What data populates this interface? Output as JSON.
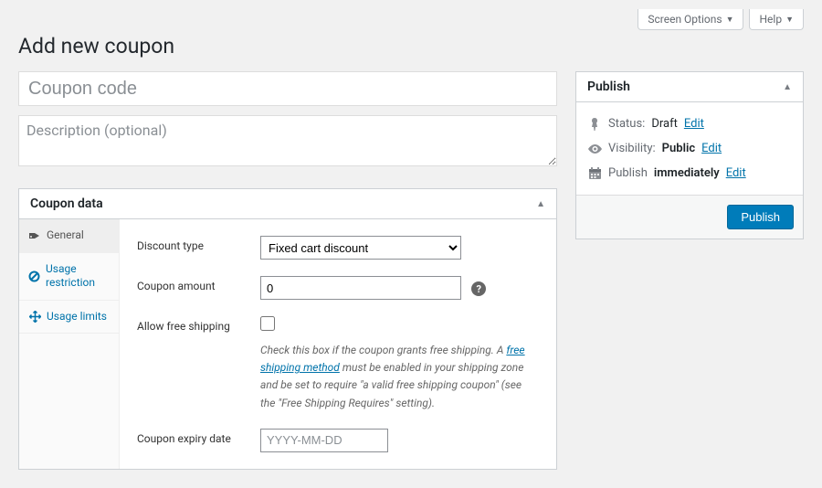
{
  "topTabs": {
    "screenOptions": "Screen Options",
    "help": "Help"
  },
  "pageTitle": "Add new coupon",
  "titleInput": {
    "placeholder": "Coupon code",
    "value": ""
  },
  "descArea": {
    "placeholder": "Description (optional)",
    "value": ""
  },
  "couponData": {
    "heading": "Coupon data",
    "tabs": {
      "general": "General",
      "usageRestriction": "Usage restriction",
      "usageLimits": "Usage limits"
    },
    "fields": {
      "discountType": {
        "label": "Discount type",
        "selected": "Fixed cart discount"
      },
      "couponAmount": {
        "label": "Coupon amount",
        "value": "0",
        "placeholder": "0"
      },
      "freeShipping": {
        "label": "Allow free shipping",
        "checked": false,
        "desc1": "Check this box if the coupon grants free shipping. A ",
        "link": "free shipping method",
        "desc2": " must be enabled in your shipping zone and be set to require \"a valid free shipping coupon\" (see the \"Free Shipping Requires\" setting)."
      },
      "expiry": {
        "label": "Coupon expiry date",
        "placeholder": "YYYY-MM-DD",
        "value": ""
      }
    }
  },
  "publish": {
    "heading": "Publish",
    "status": {
      "label": "Status:",
      "value": "Draft",
      "edit": "Edit"
    },
    "visibility": {
      "label": "Visibility:",
      "value": "Public",
      "edit": "Edit"
    },
    "schedule": {
      "label": "Publish",
      "value": "immediately",
      "edit": "Edit"
    },
    "button": "Publish"
  }
}
